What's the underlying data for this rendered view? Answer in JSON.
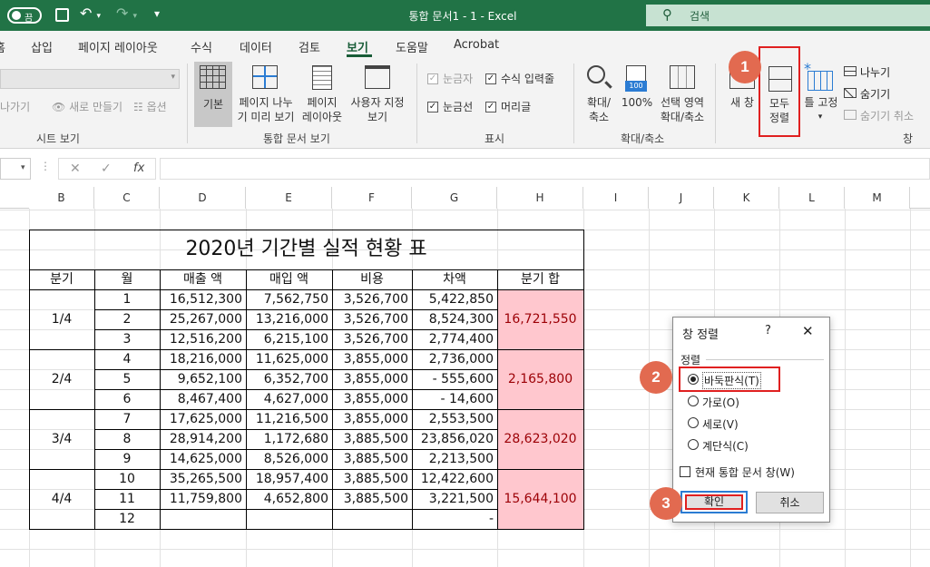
{
  "titlebar": {
    "autosave_label": "끔",
    "document_title": "통합 문서1  -  1  -  Excel",
    "search_placeholder": "검색"
  },
  "ribbon_tabs": [
    "홈",
    "삽입",
    "페이지 레이아웃",
    "수식",
    "데이터",
    "검토",
    "보기",
    "도움말",
    "Acrobat"
  ],
  "active_tab": "보기",
  "ribbon": {
    "sheet_view": {
      "keep": "나가기",
      "new": "새로 만들기",
      "options": "옵션",
      "group": "시트 보기"
    },
    "workbook_views": {
      "normal": "기본",
      "page_break": [
        "페이지 나누",
        "기 미리 보기"
      ],
      "page_layout": [
        "페이지",
        "레이아웃"
      ],
      "custom": [
        "사용자 지정",
        "보기"
      ],
      "group": "통합 문서 보기"
    },
    "show": {
      "ruler": "눈금자",
      "formula_bar": "수식 입력줄",
      "gridlines": "눈금선",
      "headings": "머리글",
      "group": "표시"
    },
    "zoom": {
      "zoom": [
        "확대/",
        "축소"
      ],
      "hundred": "100%",
      "selection": [
        "선택 영역",
        "확대/축소"
      ],
      "group": "확대/축소"
    },
    "window": {
      "new_window": "새 창",
      "arrange_all": [
        "모두",
        "정렬"
      ],
      "freeze": "틀 고정",
      "split": "나누기",
      "hide": "숨기기",
      "unhide": "숨기기 취소",
      "group": "창"
    }
  },
  "formula_bar": {
    "fx": "fx"
  },
  "columns": [
    "B",
    "C",
    "D",
    "E",
    "F",
    "G",
    "H",
    "I",
    "J",
    "K",
    "L",
    "M"
  ],
  "table": {
    "title": "2020년 기간별 실적 현황 표",
    "headers": [
      "분기",
      "월",
      "매출 액",
      "매입 액",
      "비용",
      "차액",
      "분기 합"
    ],
    "quarters": [
      "1/4",
      "2/4",
      "3/4",
      "4/4"
    ],
    "quarter_sums": [
      "16,721,550",
      "2,165,800",
      "28,623,020",
      "15,644,100"
    ],
    "rows": [
      [
        "1",
        "16,512,300",
        "7,562,750",
        "3,526,700",
        "5,422,850"
      ],
      [
        "2",
        "25,267,000",
        "13,216,000",
        "3,526,700",
        "8,524,300"
      ],
      [
        "3",
        "12,516,200",
        "6,215,100",
        "3,526,700",
        "2,774,400"
      ],
      [
        "4",
        "18,216,000",
        "11,625,000",
        "3,855,000",
        "2,736,000"
      ],
      [
        "5",
        "9,652,100",
        "6,352,700",
        "3,855,000",
        "-     555,600"
      ],
      [
        "6",
        "8,467,400",
        "4,627,000",
        "3,855,000",
        "-       14,600"
      ],
      [
        "7",
        "17,625,000",
        "11,216,500",
        "3,855,000",
        "2,553,500"
      ],
      [
        "8",
        "28,914,200",
        "1,172,680",
        "3,885,500",
        "23,856,020"
      ],
      [
        "9",
        "14,625,000",
        "8,526,000",
        "3,885,500",
        "2,213,500"
      ],
      [
        "10",
        "35,265,500",
        "18,957,400",
        "3,885,500",
        "12,422,600"
      ],
      [
        "11",
        "11,759,800",
        "4,652,800",
        "3,885,500",
        "3,221,500"
      ],
      [
        "12",
        "",
        "",
        "",
        "-"
      ]
    ]
  },
  "dialog": {
    "title": "창 정렬",
    "help": "?",
    "section": "정렬",
    "options": [
      "바둑판식(T)",
      "가로(O)",
      "세로(V)",
      "계단식(C)"
    ],
    "selected": "바둑판식(T)",
    "checkbox_label": "현재 통합 문서 창(W)",
    "ok": "확인",
    "cancel": "취소"
  },
  "callouts": [
    "1",
    "2",
    "3"
  ],
  "colors": {
    "excel_green": "#217346",
    "sum_fill": "#ffc7ce",
    "sum_text": "#9c0006",
    "callout": "#e26a50",
    "highlight": "#e02020"
  }
}
